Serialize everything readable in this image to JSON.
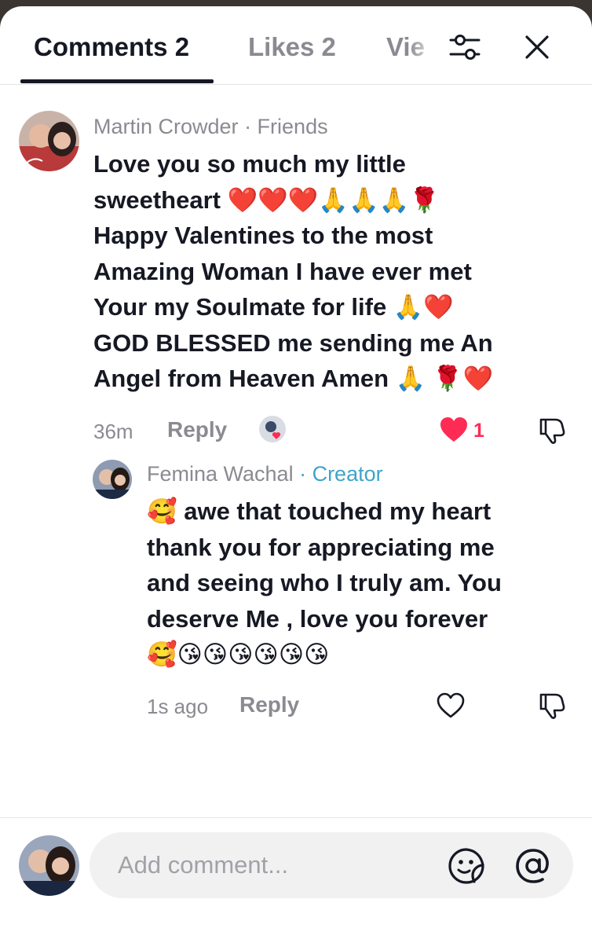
{
  "header": {
    "tabs": [
      {
        "label": "Comments 2"
      },
      {
        "label": "Likes 2"
      },
      {
        "label": "Vie"
      }
    ],
    "icons": [
      "filter-icon",
      "close-icon"
    ]
  },
  "comments": [
    {
      "author": "Martin Crowder",
      "relation": "· Friends",
      "text": "Love you so much my little\nsweetheart ❤️❤️❤️🙏🙏🙏🌹\nHappy Valentines to the most\nAmazing Woman I have ever met\nYour my Soulmate for life 🙏❤️\nGOD BLESSED me sending me An\nAngel from Heaven Amen 🙏 🌹❤️",
      "time": "36m",
      "reply_label": "Reply",
      "like_count": "1",
      "liked": true
    },
    {
      "author": "Femina Wachal",
      "relation": "· Creator",
      "text": "🥰 awe that touched my heart\nthank you for appreciating me\nand seeing who I truly am. You\ndeserve Me , love you forever\n🥰😘😘😘😘😘😘",
      "time": "1s ago",
      "reply_label": "Reply",
      "liked": false
    }
  ],
  "composer": {
    "placeholder": "Add comment...",
    "icons": [
      "emoji-icon",
      "mention-icon"
    ]
  },
  "colors": {
    "accent_like": "#fe2c55",
    "creator_label": "#3fa4c9",
    "muted_text": "#8a8b91",
    "primary_text": "#161823"
  }
}
